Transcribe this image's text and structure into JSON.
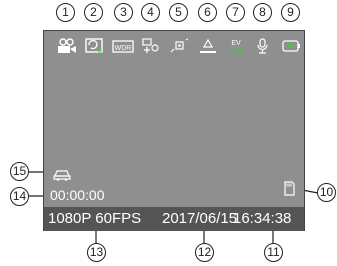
{
  "callouts": [
    "1",
    "2",
    "3",
    "4",
    "5",
    "6",
    "7",
    "8",
    "9",
    "10",
    "11",
    "12",
    "13",
    "14",
    "15"
  ],
  "status_icons": [
    {
      "name": "video-mode-icon"
    },
    {
      "name": "loop-recording-icon",
      "value": "3"
    },
    {
      "name": "wdr-icon",
      "label": "WDR"
    },
    {
      "name": "parking-monitor-icon"
    },
    {
      "name": "motion-detection-icon"
    },
    {
      "name": "g-sensor-icon"
    },
    {
      "name": "ev-icon",
      "label": "EV",
      "value": "0.0"
    },
    {
      "name": "audio-recording-icon"
    },
    {
      "name": "battery-charging-icon"
    }
  ],
  "screen": {
    "record_time": "00:00:00",
    "resolution": "1080P 60FPS",
    "date": "2017/06/15",
    "time": "16:34:38"
  },
  "colors": {
    "screen_bg": "#8f8f8f",
    "accent_green": "#3dd13d",
    "text": "#ffffff",
    "callout_line": "#222222"
  }
}
